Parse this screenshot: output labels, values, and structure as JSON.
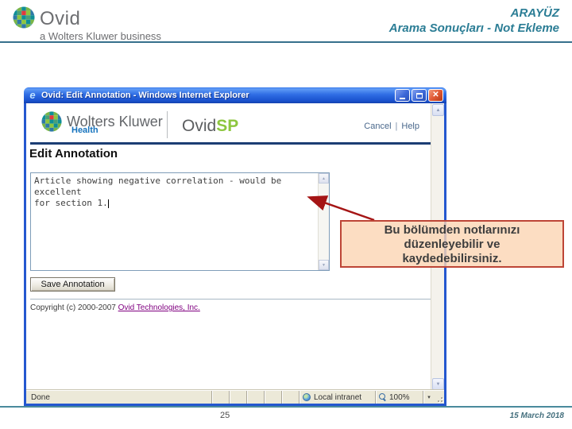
{
  "slide": {
    "brand": {
      "name": "Ovid",
      "tagline": "a Wolters Kluwer business"
    },
    "header": {
      "line1": "ARAYÜZ",
      "line2": "Arama Sonuçları  - Not Ekleme"
    },
    "footer": {
      "page": "25",
      "date": "15 March 2018"
    }
  },
  "window": {
    "title": {
      "regular": "Ovid: Edit Annotation - ",
      "bold": "Windows Internet Explorer"
    },
    "controls": {
      "close_glyph": "✕"
    },
    "header": {
      "wk_name": "Wolters Kluwer",
      "wk_sub": "Health",
      "product_gray": "Ovid",
      "product_green": "SP",
      "cancel": "Cancel",
      "divider": "|",
      "help": "Help"
    },
    "heading": "Edit Annotation",
    "annotation": {
      "text": "Article showing negative correlation - would be excellent\nfor section 1."
    },
    "save_button": "Save Annotation",
    "copyright": {
      "prefix": "Copyright (c) 2000-2007 ",
      "link": "Ovid Technologies, Inc."
    },
    "statusbar": {
      "status": "Done",
      "zone": "Local intranet",
      "zoom": "100%",
      "caret": "▾"
    },
    "scrollbar": {
      "up": "▲",
      "down": "▼"
    }
  },
  "callout": {
    "text": "Bu bölümden notlarınızı\ndüzenleyebilir ve\nkaydedebilirsiniz."
  },
  "colors": {
    "accent_teal": "#2B7D95",
    "titlebar_blue": "#2F6DE4",
    "window_border": "#2457CF",
    "callout_fill": "#FBD5B5",
    "callout_border": "#BD4536",
    "arrow_red": "#A51515",
    "link_visited": "#800080",
    "health_blue": "#1472BD",
    "sp_green": "#8DC63F"
  }
}
